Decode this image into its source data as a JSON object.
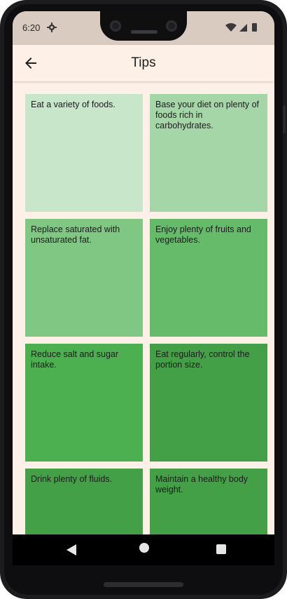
{
  "status": {
    "time": "6:20"
  },
  "appbar": {
    "title": "Tips"
  },
  "tips": [
    {
      "text": "Eat a variety of foods.",
      "color": "#c8e6c9"
    },
    {
      "text": "Base your diet on plenty of foods rich in carbohydrates.",
      "color": "#a5d6a7"
    },
    {
      "text": "Replace saturated with unsaturated fat.",
      "color": "#81c784"
    },
    {
      "text": "Enjoy plenty of fruits and vegetables.",
      "color": "#66bb6a"
    },
    {
      "text": "Reduce salt and sugar intake.",
      "color": "#4caf50"
    },
    {
      "text": "Eat regularly, control the portion size.",
      "color": "#43a047"
    },
    {
      "text": "Drink plenty of fluids.",
      "color": "#43a047"
    },
    {
      "text": "Maintain a healthy body weight.",
      "color": "#43a047"
    }
  ],
  "icons": {
    "status": [
      "gear-icon",
      "wifi-icon",
      "signal-icon",
      "battery-icon"
    ],
    "appbar": "arrow-back-icon",
    "nav": [
      "nav-back-icon",
      "nav-home-icon",
      "nav-recents-icon"
    ]
  }
}
